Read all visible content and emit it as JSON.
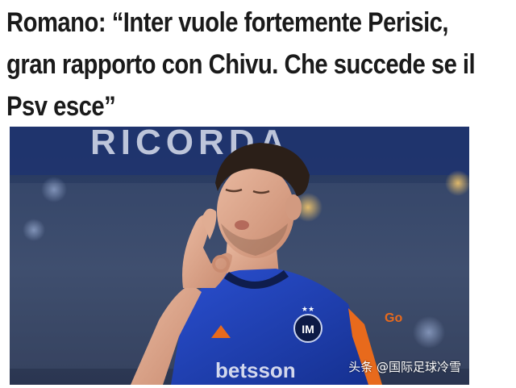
{
  "article": {
    "headline_lines": [
      "Romano: “Inter vuole fortemente Perisic,",
      "gran rapporto con Chivu. Che succede se il",
      "Psv esce”"
    ]
  },
  "photo": {
    "background_banner_text": "RICORDA",
    "jersey_sponsor": "betsson",
    "jersey_side_text": "Go"
  },
  "watermark": {
    "text": "头条 @国际足球冷雪"
  },
  "colors": {
    "headline": "#1a1a1a",
    "jersey_blue": "#1d3fb8",
    "jersey_orange": "#e86a1c",
    "background": "#ffffff"
  }
}
